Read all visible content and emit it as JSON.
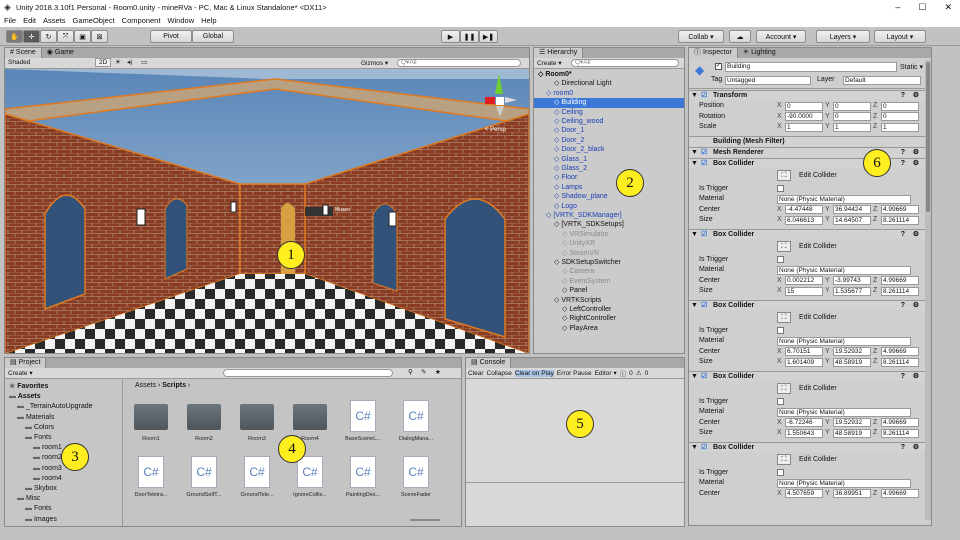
{
  "window": {
    "title": "Unity 2018.3.10f1 Personal - Room0.unity - mineRVa - PC, Mac & Linux Standalone* <DX11>",
    "minimize": "–",
    "maximize": "☐",
    "close": "✕"
  },
  "menu": [
    "File",
    "Edit",
    "Assets",
    "GameObject",
    "Component",
    "Window",
    "Help"
  ],
  "toolbar": {
    "pivot": "Pivot",
    "global": "Global",
    "play": "▶",
    "pause": "❚❚",
    "step": "▶❚",
    "collab": "Collab ▾",
    "cloud": "☁",
    "account": "Account ▾",
    "layers": "Layers ▾",
    "layout": "Layout ▾"
  },
  "scene": {
    "tab_scene": "Scene",
    "tab_game": "Game",
    "shading": "Shaded",
    "mode2d": "2D",
    "gizmos": "Gizmos ▾",
    "search": "Q▾All",
    "persp": "< Persp",
    "sign": "Museo"
  },
  "hierarchy": {
    "tab": "Hierarchy",
    "create": "Create ▾",
    "search": "Q▾All",
    "items": [
      {
        "label": "Room0*",
        "indent": 0,
        "style": "bold"
      },
      {
        "label": "Directional Light",
        "indent": 2,
        "style": "normal"
      },
      {
        "label": "room0",
        "indent": 1,
        "style": "blue"
      },
      {
        "label": "Building",
        "indent": 2,
        "style": "selected"
      },
      {
        "label": "Ceiling",
        "indent": 2,
        "style": "blue"
      },
      {
        "label": "Ceiling_wood",
        "indent": 2,
        "style": "blue"
      },
      {
        "label": "Door_1",
        "indent": 2,
        "style": "blue"
      },
      {
        "label": "Door_2",
        "indent": 2,
        "style": "blue"
      },
      {
        "label": "Door_2_black",
        "indent": 2,
        "style": "blue"
      },
      {
        "label": "Glass_1",
        "indent": 2,
        "style": "blue"
      },
      {
        "label": "Glass_2",
        "indent": 2,
        "style": "blue"
      },
      {
        "label": "Floor",
        "indent": 2,
        "style": "blue"
      },
      {
        "label": "Lamps",
        "indent": 2,
        "style": "blue"
      },
      {
        "label": "Shadow_plane",
        "indent": 2,
        "style": "blue"
      },
      {
        "label": "Logo",
        "indent": 2,
        "style": "blue"
      },
      {
        "label": "[VRTK_SDKManager]",
        "indent": 1,
        "style": "blue"
      },
      {
        "label": "[VRTK_SDKSetups]",
        "indent": 2,
        "style": "normal"
      },
      {
        "label": "VRSimulator",
        "indent": 3,
        "style": "gray"
      },
      {
        "label": "UnityXR",
        "indent": 3,
        "style": "gray"
      },
      {
        "label": "SteamVR",
        "indent": 3,
        "style": "gray"
      },
      {
        "label": "SDKSetupSwitcher",
        "indent": 2,
        "style": "normal"
      },
      {
        "label": "Camera",
        "indent": 3,
        "style": "gray"
      },
      {
        "label": "EventSystem",
        "indent": 3,
        "style": "gray"
      },
      {
        "label": "Panel",
        "indent": 3,
        "style": "normal"
      },
      {
        "label": "VRTKScripts",
        "indent": 2,
        "style": "normal"
      },
      {
        "label": "LeftController",
        "indent": 3,
        "style": "normal"
      },
      {
        "label": "RightController",
        "indent": 3,
        "style": "normal"
      },
      {
        "label": "PlayArea",
        "indent": 3,
        "style": "normal"
      }
    ]
  },
  "inspector": {
    "tab": "Inspector",
    "tab2": "Lighting",
    "object_name": "Building",
    "static": "Static ▾",
    "tag_label": "Tag",
    "tag": "Untagged",
    "layer_label": "Layer",
    "layer": "Default",
    "transform": {
      "title": "Transform",
      "position": {
        "label": "Position",
        "x": "0",
        "y": "0",
        "z": "0"
      },
      "rotation": {
        "label": "Rotation",
        "x": "-90.0000",
        "y": "0",
        "z": "0"
      },
      "scale": {
        "label": "Scale",
        "x": "1",
        "y": "1",
        "z": "1"
      }
    },
    "mesh_filter": "Building (Mesh Filter)",
    "mesh_renderer": "Mesh Renderer",
    "colliders": [
      {
        "title": "Box Collider",
        "edit": "Edit Collider",
        "material": "None (Physic Material)",
        "center": [
          "-4.47448",
          "36.94424",
          "4.99669"
        ],
        "size": [
          "6.046613",
          "14.64507",
          "8.261114"
        ]
      },
      {
        "title": "Box Collider",
        "edit": "Edit Collider",
        "material": "None (Physic Material)",
        "center": [
          "0.002212",
          "-3.99743",
          "4.99669"
        ],
        "size": [
          "15",
          "1.535677",
          "8.261114"
        ]
      },
      {
        "title": "Box Collider",
        "edit": "Edit Collider",
        "material": "None (Physic Material)",
        "center": [
          "6.70151",
          "19.52932",
          "4.99669"
        ],
        "size": [
          "1.601409",
          "48.58919",
          "8.261114"
        ]
      },
      {
        "title": "Box Collider",
        "edit": "Edit Collider",
        "material": "None (Physic Material)",
        "center": [
          "-6.72246",
          "19.52932",
          "4.99669"
        ],
        "size": [
          "1.550643",
          "48.58919",
          "8.261114"
        ]
      },
      {
        "title": "Box Collider",
        "edit": "Edit Collider",
        "material": "None (Physic Material)",
        "center": [
          "4.507659",
          "36.89951",
          "4.99669"
        ],
        "size": [
          "",
          "",
          ""
        ]
      }
    ],
    "labels": {
      "is_trigger": "Is Trigger",
      "material": "Material",
      "center": "Center",
      "size": "Size",
      "x": "X",
      "y": "Y",
      "z": "Z"
    }
  },
  "project": {
    "tab": "Project",
    "create": "Create ▾",
    "breadcrumb_root": "Assets",
    "breadcrumb_leaf": "Scripts",
    "tree": [
      {
        "label": "Favorites",
        "indent": 0,
        "bold": true
      },
      {
        "label": "Assets",
        "indent": 0,
        "bold": true
      },
      {
        "label": "_TerrainAutoUpgrade",
        "indent": 1
      },
      {
        "label": "Materials",
        "indent": 1
      },
      {
        "label": "Colors",
        "indent": 2
      },
      {
        "label": "Fonts",
        "indent": 2
      },
      {
        "label": "room1",
        "indent": 3
      },
      {
        "label": "room2",
        "indent": 3
      },
      {
        "label": "room3",
        "indent": 3
      },
      {
        "label": "room4",
        "indent": 3
      },
      {
        "label": "Skybox",
        "indent": 2
      },
      {
        "label": "Misc",
        "indent": 1
      },
      {
        "label": "Fonts",
        "indent": 2
      },
      {
        "label": "Images",
        "indent": 2
      }
    ],
    "assets": [
      {
        "name": "Room1",
        "kind": "folder"
      },
      {
        "name": "Room2",
        "kind": "folder"
      },
      {
        "name": "Room3",
        "kind": "folder"
      },
      {
        "name": "Room4",
        "kind": "folder"
      },
      {
        "name": "BaseSceneL...",
        "kind": "cs"
      },
      {
        "name": "DialogMana...",
        "kind": "cs"
      },
      {
        "name": "DoorTeletra...",
        "kind": "cs"
      },
      {
        "name": "GroundSelfT...",
        "kind": "cs"
      },
      {
        "name": "GroundTele...",
        "kind": "cs"
      },
      {
        "name": "IgnoreCollis...",
        "kind": "cs"
      },
      {
        "name": "PaintingDes...",
        "kind": "cs"
      },
      {
        "name": "SceneFader",
        "kind": "cs"
      }
    ]
  },
  "console": {
    "tab": "Console",
    "buttons": [
      "Clear",
      "Collapse",
      "Clear on Play",
      "Error Pause",
      "Editor ▾"
    ],
    "count_info": "0",
    "count_warn": "0"
  },
  "callouts": [
    "1",
    "2",
    "3",
    "4",
    "5",
    "6"
  ],
  "colors": {
    "accent": "#3b78d8",
    "callout": "#ffee1f"
  }
}
